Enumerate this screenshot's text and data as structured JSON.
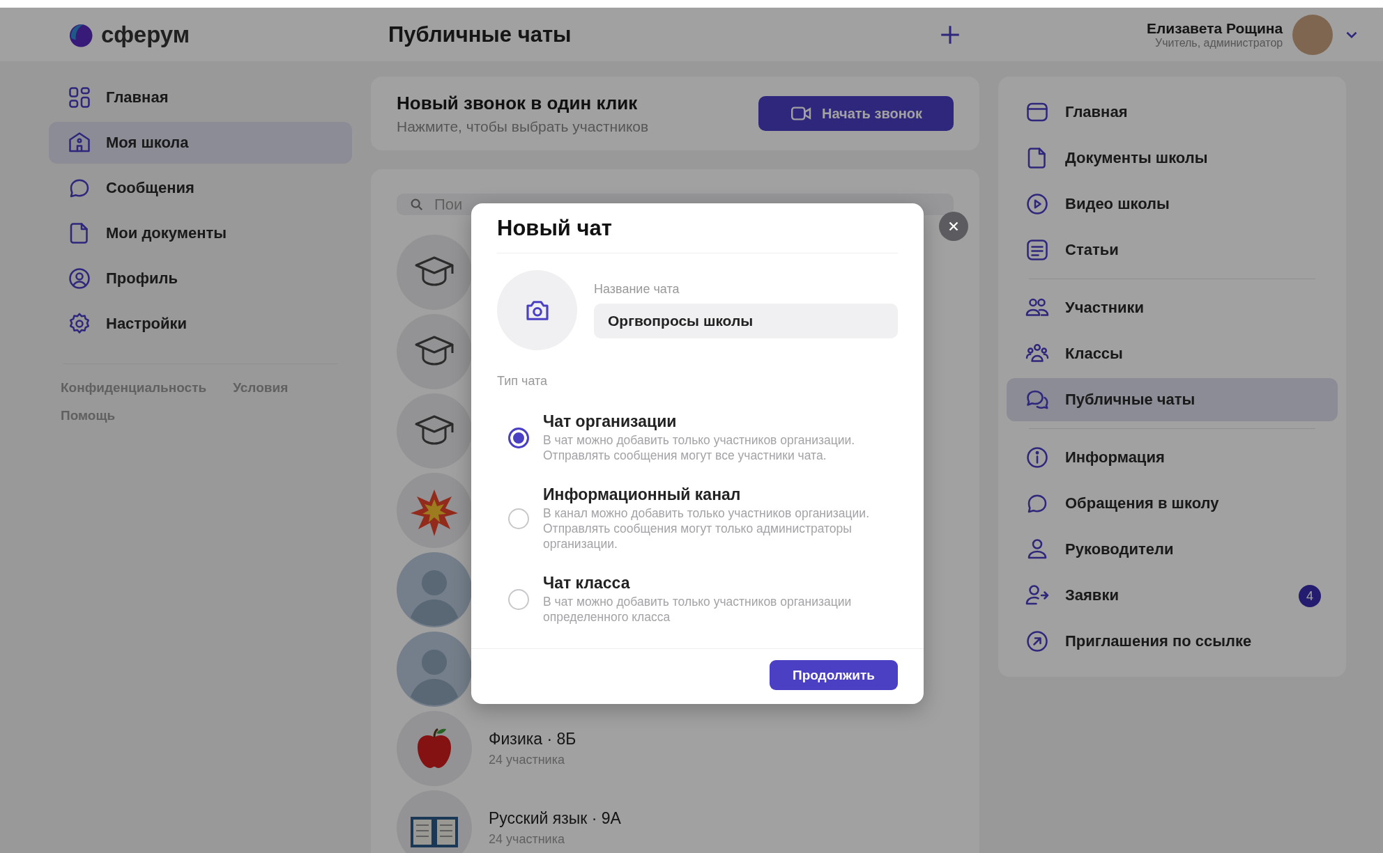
{
  "header": {
    "logo": "сферум",
    "title": "Публичные чаты",
    "user": {
      "name": "Елизавета Рощина",
      "role": "Учитель, администратор"
    }
  },
  "left_nav": {
    "items": [
      {
        "label": "Главная",
        "selected": false
      },
      {
        "label": "Моя школа",
        "selected": true
      },
      {
        "label": "Сообщения",
        "selected": false
      },
      {
        "label": "Мои документы",
        "selected": false
      },
      {
        "label": "Профиль",
        "selected": false
      },
      {
        "label": "Настройки",
        "selected": false
      }
    ],
    "footer_links": [
      "Конфиденциальность",
      "Условия",
      "Помощь"
    ]
  },
  "call_card": {
    "title": "Новый звонок в один клик",
    "subtitle": "Нажмите, чтобы выбрать участников",
    "button": "Начать звонок"
  },
  "search": {
    "placeholder": "Пои"
  },
  "chats": [
    {
      "kind": "cap"
    },
    {
      "kind": "cap"
    },
    {
      "kind": "cap"
    },
    {
      "kind": "burst"
    },
    {
      "kind": "person"
    },
    {
      "kind": "person"
    },
    {
      "kind": "apple",
      "name": "Физика · 8Б",
      "members": "24 участника"
    },
    {
      "kind": "book",
      "name": "Русский язык · 9А",
      "members": "24 участника"
    }
  ],
  "right_nav": {
    "groups": [
      [
        {
          "label": "Главная",
          "selected": false
        },
        {
          "label": "Документы школы",
          "selected": false
        },
        {
          "label": "Видео школы",
          "selected": false
        },
        {
          "label": "Статьи",
          "selected": false
        }
      ],
      [
        {
          "label": "Участники",
          "selected": false
        },
        {
          "label": "Классы",
          "selected": false
        },
        {
          "label": "Публичные чаты",
          "selected": true
        }
      ],
      [
        {
          "label": "Информация",
          "selected": false
        },
        {
          "label": "Обращения в школу",
          "selected": false
        },
        {
          "label": "Руководители",
          "selected": false
        },
        {
          "label": "Заявки",
          "selected": false,
          "badge": "4"
        },
        {
          "label": "Приглашения по ссылке",
          "selected": false
        }
      ]
    ]
  },
  "modal": {
    "title": "Новый чат",
    "name_field": {
      "label": "Название чата",
      "value": "Оргвопросы школы"
    },
    "type_label": "Тип чата",
    "options": [
      {
        "title": "Чат организации",
        "description": "В чат можно добавить только участников организации. Отправлять сообщения могут все участники чата.",
        "selected": true
      },
      {
        "title": "Информационный канал",
        "description": "В канал можно добавить только участников организации. Отправлять сообщения могут только администраторы организации.",
        "selected": false
      },
      {
        "title": "Чат класса",
        "description": "В чат можно добавить только участников организации определенного класса",
        "selected": false
      }
    ],
    "button": "Продолжить"
  }
}
